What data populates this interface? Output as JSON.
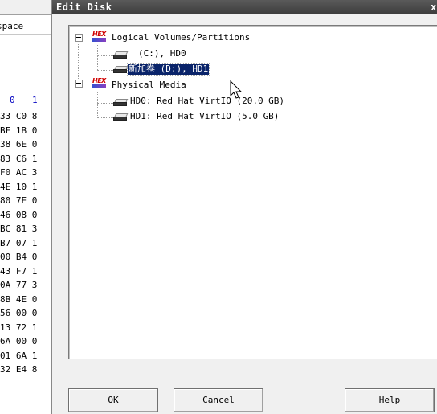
{
  "background_app": {
    "space_header": "space",
    "hex_columns": [
      "0",
      "1"
    ],
    "hex_rows": [
      "33 C0 8",
      "BF 1B 0",
      "38 6E 0",
      "83 C6 1",
      "F0 AC 3",
      "4E 10 1",
      "80 7E 0",
      "46 08 0",
      "BC 81 3",
      "B7 07 1",
      "00 B4 0",
      "43 F7 1",
      "0A 77 3",
      "8B 4E 0",
      "56 00 0",
      "13 72 1",
      "6A 00 0",
      "01 6A 1",
      "32 E4 8"
    ]
  },
  "dialog": {
    "title": "Edit Disk",
    "close_glyph": "x",
    "tree": {
      "logical": {
        "label": "Logical Volumes/Partitions",
        "icon": "hex-logo-icon",
        "items": [
          {
            "label": "(C:), HD0",
            "icon": "drive-icon",
            "selected": false
          },
          {
            "label": "新加卷 (D:), HD1",
            "icon": "drive-icon",
            "selected": true
          }
        ]
      },
      "physical": {
        "label": "Physical Media",
        "icon": "hex-logo-icon",
        "items": [
          {
            "label": "HD0: Red Hat VirtIO (20.0 GB)",
            "icon": "drive-icon"
          },
          {
            "label": "HD1: Red Hat VirtIO (5.0 GB)",
            "icon": "drive-icon"
          }
        ]
      }
    },
    "buttons": {
      "ok": {
        "mnemonic": "O",
        "rest": "K"
      },
      "cancel": {
        "pre": "C",
        "mnemonic": "a",
        "rest": "ncel"
      },
      "help": {
        "mnemonic": "H",
        "rest": "elp"
      }
    }
  }
}
